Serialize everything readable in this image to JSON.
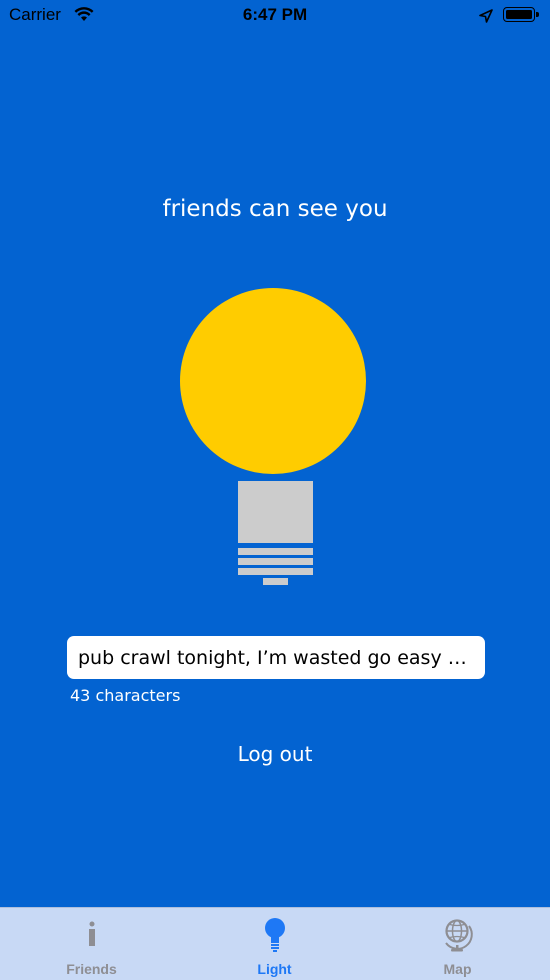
{
  "status_bar": {
    "carrier": "Carrier",
    "time": "6:47 PM",
    "icons": [
      "wifi-icon",
      "location-arrow-icon",
      "battery-icon"
    ]
  },
  "main": {
    "status_text": "friends can see you",
    "bulb": {
      "glass_color": "#ffcc00",
      "base_color": "#cccccc",
      "state": "on"
    },
    "message": {
      "value": "pub crawl tonight, I’m wasted go easy o...",
      "placeholder": ""
    },
    "char_count": "43 characters",
    "logout_label": "Log out"
  },
  "tab_bar": {
    "active": "Light",
    "tabs": [
      {
        "label": "Friends",
        "icon": "info-icon"
      },
      {
        "label": "Light",
        "icon": "lightbulb-icon"
      },
      {
        "label": "Map",
        "icon": "globe-icon"
      }
    ]
  },
  "colors": {
    "background": "#0363d1",
    "tab_bar": "#c8d9f5",
    "accent": "#1e78f5",
    "inactive": "#8e8e93"
  }
}
